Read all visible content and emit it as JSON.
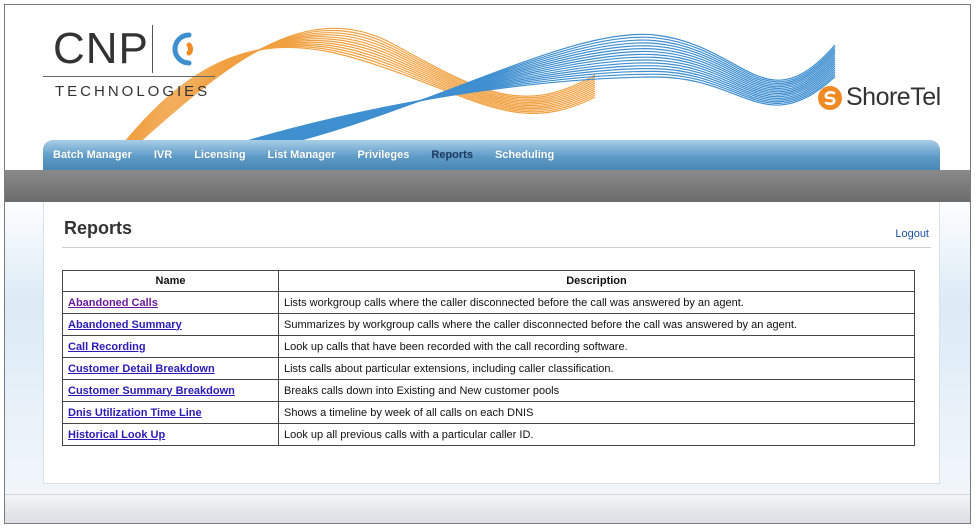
{
  "brand": {
    "cnp": "CNP",
    "technologies": "TECHNOLOGIES",
    "shoretel": "ShoreTel",
    "accent_orange": "#f08a24",
    "accent_blue": "#3f8fd0"
  },
  "nav": {
    "items": [
      {
        "label": "Batch Manager",
        "active": false
      },
      {
        "label": "IVR",
        "active": false
      },
      {
        "label": "Licensing",
        "active": false
      },
      {
        "label": "List Manager",
        "active": false
      },
      {
        "label": "Privileges",
        "active": false
      },
      {
        "label": "Reports",
        "active": true
      },
      {
        "label": "Scheduling",
        "active": false
      }
    ]
  },
  "page": {
    "title": "Reports",
    "logout": "Logout"
  },
  "table": {
    "headers": [
      "Name",
      "Description"
    ],
    "rows": [
      {
        "name": "Abandoned Calls",
        "description": "Lists workgroup calls where the caller disconnected before the call was answered by an agent."
      },
      {
        "name": "Abandoned Summary",
        "description": "Summarizes by workgroup calls where the caller disconnected before the call was answered by an agent."
      },
      {
        "name": "Call Recording",
        "description": "Look up calls that have been recorded with the call recording software."
      },
      {
        "name": "Customer Detail Breakdown",
        "description": "Lists calls about particular extensions, including caller classification."
      },
      {
        "name": "Customer Summary Breakdown",
        "description": "Breaks calls down into Existing and New customer pools"
      },
      {
        "name": "Dnis Utilization Time Line",
        "description": "Shows a timeline by week of all calls on each DNIS"
      },
      {
        "name": "Historical Look Up",
        "description": "Look up all previous calls with a particular caller ID."
      }
    ]
  }
}
